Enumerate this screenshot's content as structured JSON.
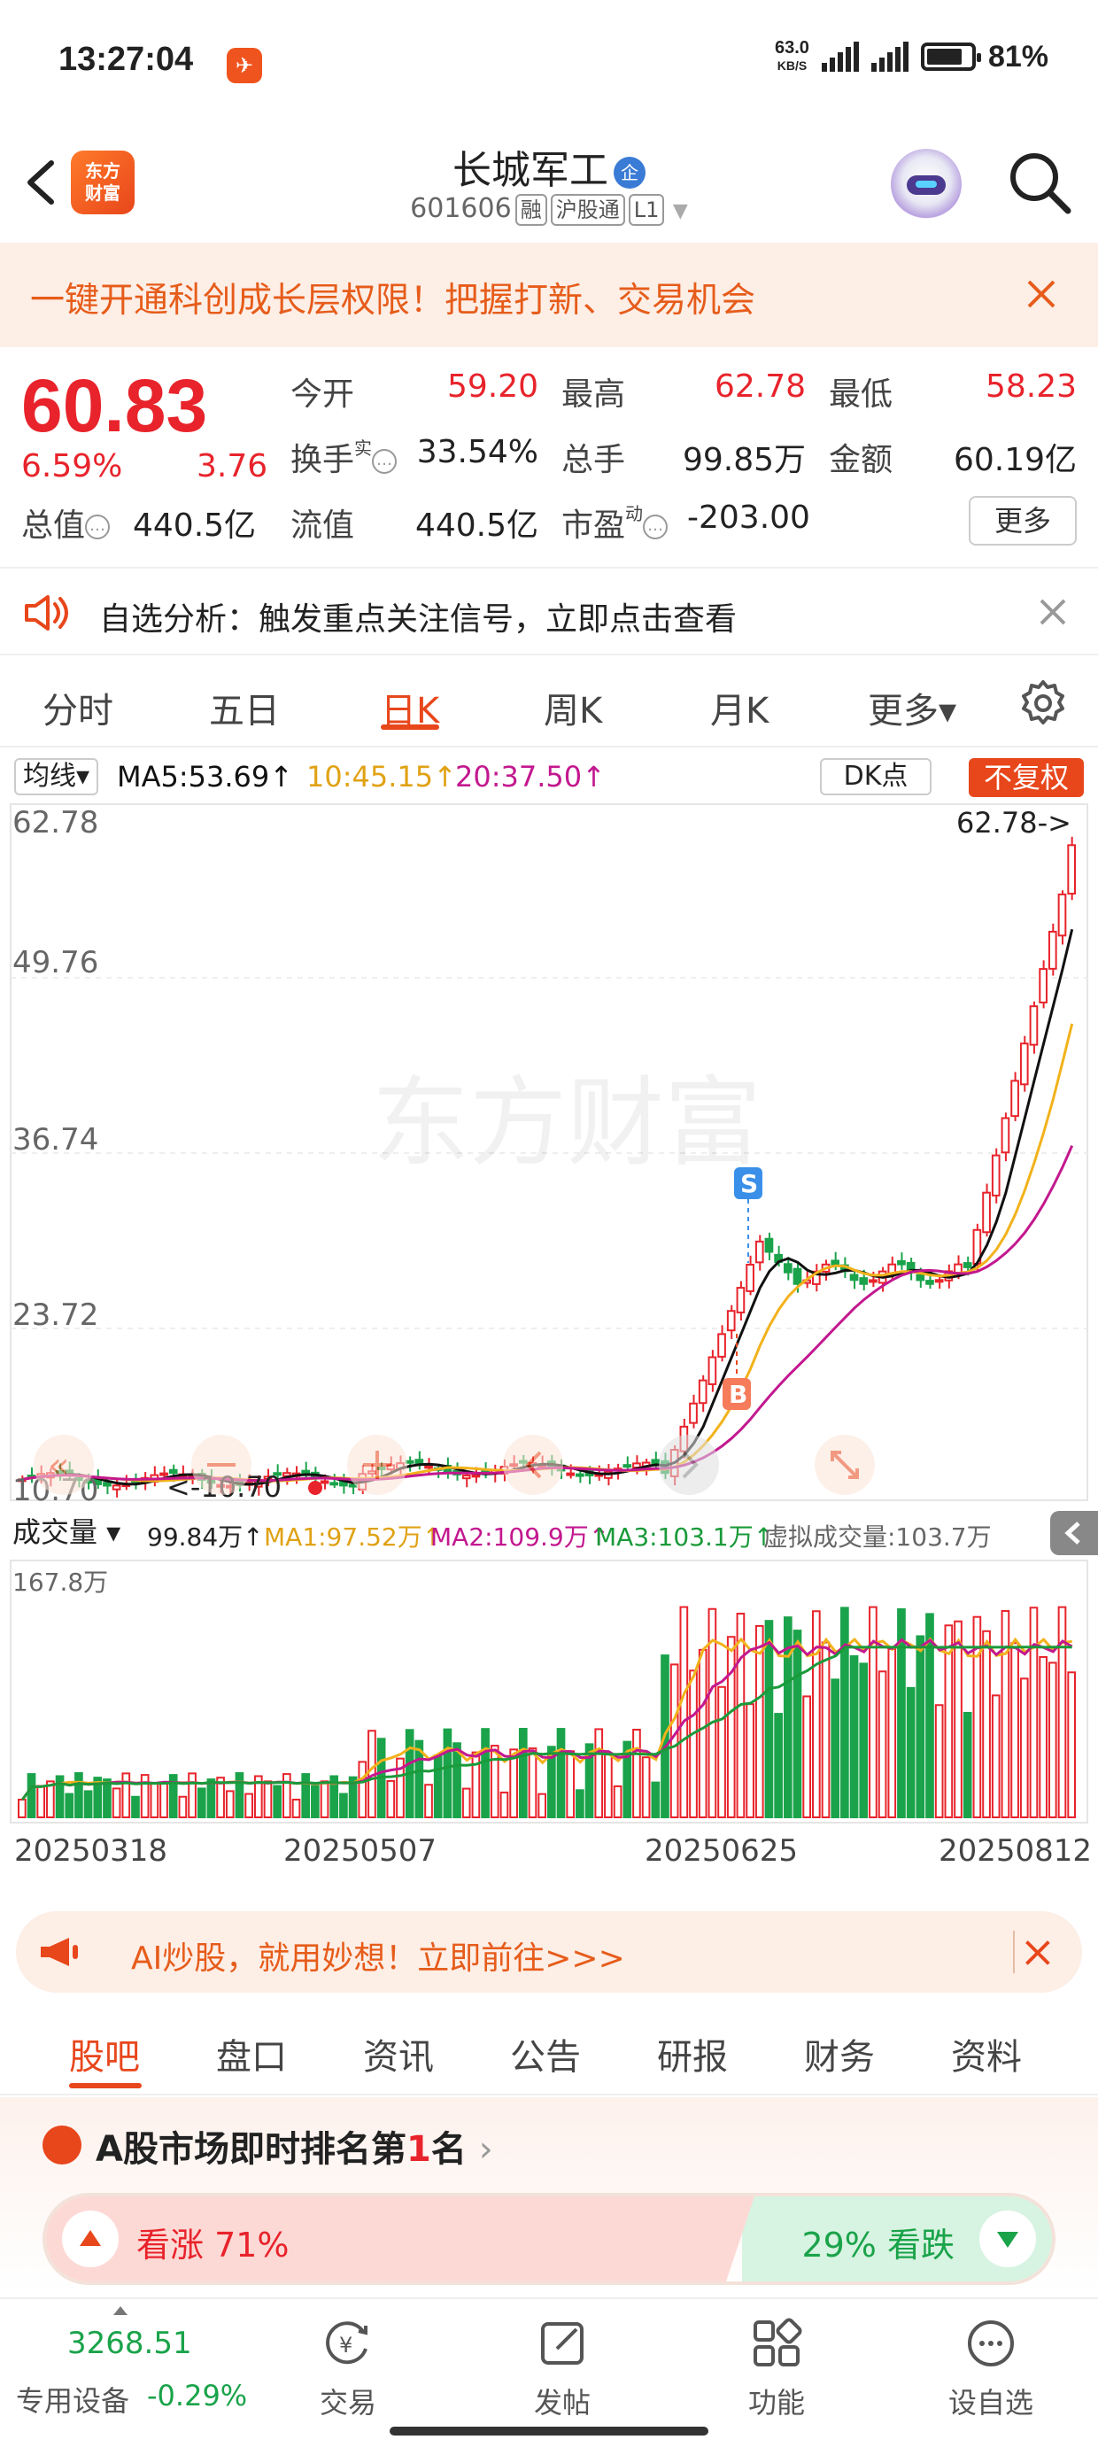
{
  "status_bar": {
    "time": "13:27:04",
    "net_speed": "63.0",
    "net_unit": "KB/S",
    "battery": "81%"
  },
  "header": {
    "brand_logo": "东方\n财富",
    "stock_name": "长城军工",
    "ent_badge": "企",
    "code": "601606",
    "tags": [
      "融",
      "沪股通",
      "L1"
    ]
  },
  "promo_banner": {
    "text": "一键开通科创成长层权限！把握打新、交易机会"
  },
  "quote": {
    "price": "60.83",
    "change_pct": "6.59%",
    "change": "3.76",
    "open_label": "今开",
    "open": "59.20",
    "high_label": "最高",
    "high": "62.78",
    "low_label": "最低",
    "low": "58.23",
    "turnover_label": "换手",
    "turnover_sup": "实",
    "turnover": "33.54%",
    "volume_label": "总手",
    "volume": "99.85万",
    "amount_label": "金额",
    "amount": "60.19亿",
    "mcap_label": "总值",
    "mcap": "440.5亿",
    "float_label": "流值",
    "float": "440.5亿",
    "pe_label": "市盈",
    "pe_sup": "动",
    "pe": "-203.00",
    "more_btn": "更多"
  },
  "notice": {
    "text": "自选分析：触发重点关注信号，立即点击查看"
  },
  "period_tabs": {
    "items": [
      "分时",
      "五日",
      "日K",
      "周K",
      "月K",
      "更多▾"
    ],
    "active": "日K"
  },
  "ma_bar": {
    "selector": "均线▾",
    "ma5": "MA5:53.69↑",
    "ma10": "10:45.15↑",
    "ma20": "20:37.50↑",
    "dk": "DK点",
    "fq": "不复权"
  },
  "kchart": {
    "y_labels": [
      "62.78",
      "49.76",
      "36.74",
      "23.72",
      "10.70"
    ],
    "high_marker": "62.78->",
    "low_marker": "<-10.70",
    "watermark": "东方财富",
    "markers": {
      "sell": "S",
      "buy": "B"
    },
    "colors": {
      "up": "#e8232b",
      "down": "#1aa34a",
      "ma5": "#111111",
      "ma10": "#f2b21b",
      "ma20": "#c3188f"
    }
  },
  "volume_bar": {
    "selector": "成交量 ▾",
    "current": "99.84万↑",
    "ma1": "MA1:97.52万↑",
    "ma2": "MA2:109.9万↑",
    "ma3": "MA3:103.1万↑",
    "virtual": "虚拟成交量:103.7万",
    "max_label": "167.8万"
  },
  "dates": [
    "20250318",
    "20250507",
    "20250625",
    "20250812"
  ],
  "ai_banner": {
    "text": "AI炒股，就用妙想！立即前往>>>"
  },
  "section_tabs": {
    "items": [
      "股吧",
      "盘口",
      "资讯",
      "公告",
      "研报",
      "财务",
      "资料"
    ],
    "active": "股吧"
  },
  "ranking": {
    "prefix": "A股市场即时排名第",
    "rank": "1",
    "suffix": "名",
    "arrow": "›"
  },
  "sentiment": {
    "up_label": "看涨 71%",
    "down_label": "29% 看跌"
  },
  "bottom_nav": {
    "index_value": "3268.51",
    "index_label": "专用设备",
    "index_change": "-0.29%",
    "items": [
      "交易",
      "发帖",
      "功能",
      "设自选"
    ]
  }
}
